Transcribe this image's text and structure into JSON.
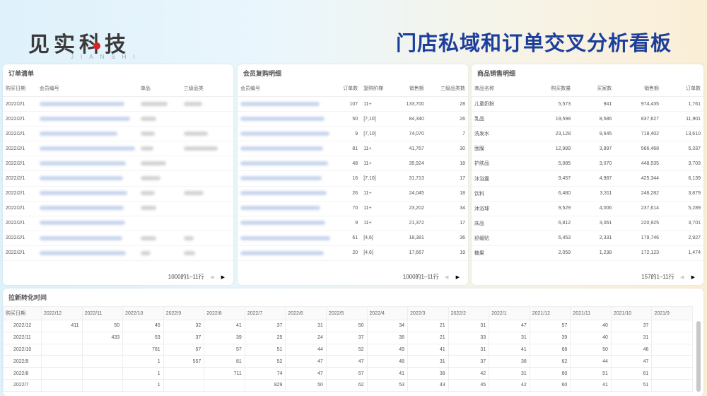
{
  "header": {
    "logo_text": "见实科技",
    "logo_sub": "JIANSHI",
    "title": "门店私域和订单交叉分析看板"
  },
  "orders": {
    "title": "订单清单",
    "columns": [
      "购买日期",
      "会员编号",
      "单品",
      "三级品类"
    ],
    "rows": [
      {
        "date": "2022/2/1"
      },
      {
        "date": "2022/2/1"
      },
      {
        "date": "2022/2/1"
      },
      {
        "date": "2022/2/1"
      },
      {
        "date": "2022/2/1"
      },
      {
        "date": "2022/2/1"
      },
      {
        "date": "2022/2/1"
      },
      {
        "date": "2022/2/1"
      },
      {
        "date": "2022/2/1"
      },
      {
        "date": "2022/2/1"
      },
      {
        "date": "2022/2/1"
      }
    ],
    "pager": "1000的1–11行"
  },
  "repurchase": {
    "title": "会员复购明细",
    "columns": [
      "会员编号",
      "订单数",
      "复购阶梯",
      "销售额",
      "三级品类数"
    ],
    "rows": [
      [
        "107",
        "11+",
        "133,700",
        "28"
      ],
      [
        "50",
        "[7,10]",
        "84,340",
        "26"
      ],
      [
        "9",
        "[7,10]",
        "74,070",
        "7"
      ],
      [
        "81",
        "11+",
        "41,767",
        "30"
      ],
      [
        "48",
        "11+",
        "35,924",
        "18"
      ],
      [
        "16",
        "[7,10]",
        "31,713",
        "17"
      ],
      [
        "26",
        "11+",
        "24,045",
        "18"
      ],
      [
        "70",
        "11+",
        "23,202",
        "34"
      ],
      [
        "9",
        "11+",
        "21,372",
        "17"
      ],
      [
        "61",
        "[4,6]",
        "18,381",
        "36"
      ],
      [
        "20",
        "[4,6]",
        "17,667",
        "19"
      ]
    ],
    "pager": "1000的1–11行"
  },
  "products": {
    "title": "商品销售明细",
    "columns": [
      "商品名称",
      "购买数量",
      "买家数",
      "销售额",
      "订单数"
    ],
    "rows": [
      [
        "儿童奶粉",
        "5,573",
        "941",
        "974,435",
        "1,761"
      ],
      [
        "乳品",
        "19,598",
        "8,586",
        "837,627",
        "11,901"
      ],
      [
        "洗发水",
        "23,128",
        "9,645",
        "718,402",
        "13,610"
      ],
      [
        "面膜",
        "12,989",
        "3,897",
        "566,468",
        "5,337"
      ],
      [
        "护肤品",
        "5,085",
        "3,070",
        "448,535",
        "3,703"
      ],
      [
        "沐浴露",
        "9,457",
        "4,987",
        "425,344",
        "6,139"
      ],
      [
        "饮料",
        "6,480",
        "3,311",
        "246,282",
        "3,879"
      ],
      [
        "沐浴球",
        "9,529",
        "4,006",
        "237,614",
        "5,289"
      ],
      [
        "床品",
        "6,812",
        "3,061",
        "220,925",
        "3,701"
      ],
      [
        "舒缓贴",
        "6,453",
        "2,331",
        "179,746",
        "2,927"
      ],
      [
        "糖果",
        "2,059",
        "1,238",
        "172,123",
        "1,474"
      ]
    ],
    "pager": "157的1–11行"
  },
  "cohort": {
    "title": "拉新转化时间",
    "corner": "购买日期",
    "columns": [
      "2022/12",
      "2022/11",
      "2022/10",
      "2022/9",
      "2022/8",
      "2022/7",
      "2022/6",
      "2022/5",
      "2022/4",
      "2022/3",
      "2022/2",
      "2022/1",
      "2021/12",
      "2021/11",
      "2021/10",
      "2021/9"
    ],
    "rows": [
      {
        "label": "2022/12",
        "cells": [
          "411",
          "50",
          "45",
          "32",
          "41",
          "37",
          "31",
          "50",
          "34",
          "21",
          "31",
          "47",
          "57",
          "40",
          "37",
          ""
        ]
      },
      {
        "label": "2022/11",
        "cells": [
          "",
          "433",
          "53",
          "37",
          "39",
          "25",
          "24",
          "37",
          "38",
          "21",
          "33",
          "31",
          "39",
          "40",
          "31",
          ""
        ]
      },
      {
        "label": "2022/10",
        "cells": [
          "",
          "",
          "781",
          "57",
          "57",
          "51",
          "44",
          "52",
          "49",
          "41",
          "31",
          "41",
          "68",
          "50",
          "46",
          ""
        ]
      },
      {
        "label": "2022/9",
        "cells": [
          "",
          "",
          "1",
          "557",
          "81",
          "52",
          "47",
          "47",
          "48",
          "31",
          "37",
          "38",
          "62",
          "44",
          "47",
          ""
        ]
      },
      {
        "label": "2022/8",
        "cells": [
          "",
          "",
          "1",
          "",
          "711",
          "74",
          "47",
          "57",
          "41",
          "38",
          "42",
          "31",
          "60",
          "51",
          "61",
          ""
        ]
      },
      {
        "label": "2022/7",
        "cells": [
          "",
          "",
          "1",
          "",
          "",
          "829",
          "50",
          "62",
          "53",
          "43",
          "45",
          "42",
          "60",
          "41",
          "51",
          ""
        ]
      }
    ]
  }
}
